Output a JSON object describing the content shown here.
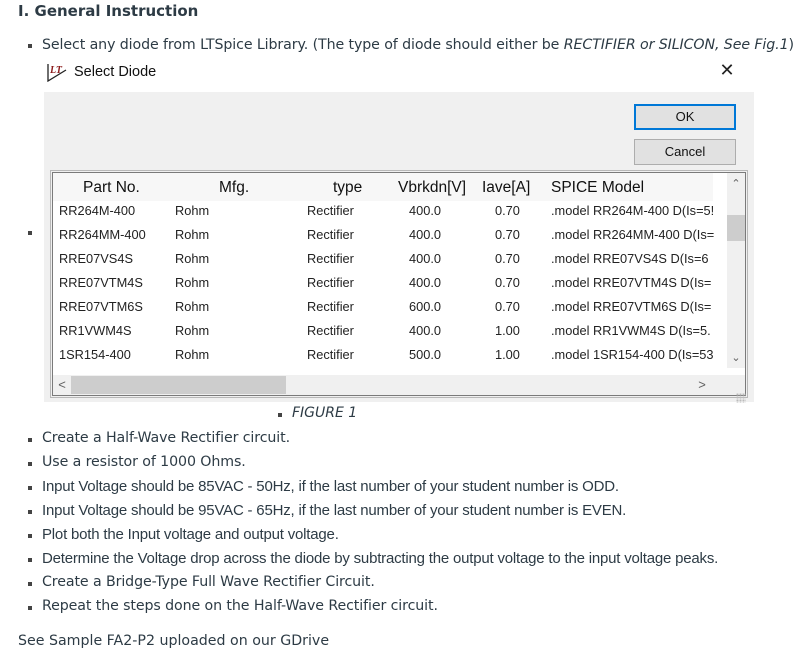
{
  "heading": "I. General Instruction",
  "intro": {
    "text_before": "Select any diode from LTSpice Library. (The type of diode should either be ",
    "emphasis": "RECTIFIER or SILICON, See Fig.1",
    "text_after": ")"
  },
  "dialog": {
    "title": "Select Diode",
    "icon": "ltspice-logo-icon",
    "close_icon": "close-icon",
    "close_glyph": "✕",
    "ok_label": "OK",
    "cancel_label": "Cancel",
    "columns": [
      "Part No.",
      "Mfg.",
      "type",
      "Vbrkdn[V]",
      "Iave[A]",
      "SPICE Model"
    ],
    "rows": [
      {
        "part": "RR264M-400",
        "mfg": "Rohm",
        "type": "Rectifier",
        "vbrkdn": "400.0",
        "iave": "0.70",
        "model": ".model RR264M-400 D(Is=5!"
      },
      {
        "part": "RR264MM-400",
        "mfg": "Rohm",
        "type": "Rectifier",
        "vbrkdn": "400.0",
        "iave": "0.70",
        "model": ".model RR264MM-400 D(Is="
      },
      {
        "part": "RRE07VS4S",
        "mfg": "Rohm",
        "type": "Rectifier",
        "vbrkdn": "400.0",
        "iave": "0.70",
        "model": ".model RRE07VS4S D(Is=6"
      },
      {
        "part": "RRE07VTM4S",
        "mfg": "Rohm",
        "type": "Rectifier",
        "vbrkdn": "400.0",
        "iave": "0.70",
        "model": ".model RRE07VTM4S D(Is="
      },
      {
        "part": "RRE07VTM6S",
        "mfg": "Rohm",
        "type": "Rectifier",
        "vbrkdn": "600.0",
        "iave": "0.70",
        "model": ".model RRE07VTM6S D(Is="
      },
      {
        "part": "RR1VWM4S",
        "mfg": "Rohm",
        "type": "Rectifier",
        "vbrkdn": "400.0",
        "iave": "1.00",
        "model": ".model RR1VWM4S D(Is=5."
      },
      {
        "part": "1SR154-400",
        "mfg": "Rohm",
        "type": "Rectifier",
        "vbrkdn": "500.0",
        "iave": "1.00",
        "model": ".model 1SR154-400 D(Is=53"
      }
    ],
    "scroll": {
      "up": "⌃",
      "down": "⌄",
      "left": "<",
      "right": ">"
    }
  },
  "figure_caption": "FIGURE 1",
  "steps": [
    "Create a Half-Wave Rectifier circuit.",
    "Use a resistor of 1000 Ohms.",
    "Input Voltage should be 85VAC - 50Hz, if the last number of your student number is ODD.",
    "Input Voltage should be 95VAC - 65Hz, if the last number of your student number is EVEN.",
    "Plot both the Input voltage and output voltage.",
    "Determine the Voltage drop across the diode by subtracting the output voltage to the input voltage peaks.",
    "Create a Bridge-Type Full Wave Rectifier Circuit.",
    "Repeat the steps done on the Half-Wave Rectifier circuit."
  ],
  "footer": "See Sample FA2-P2 uploaded on our GDrive"
}
